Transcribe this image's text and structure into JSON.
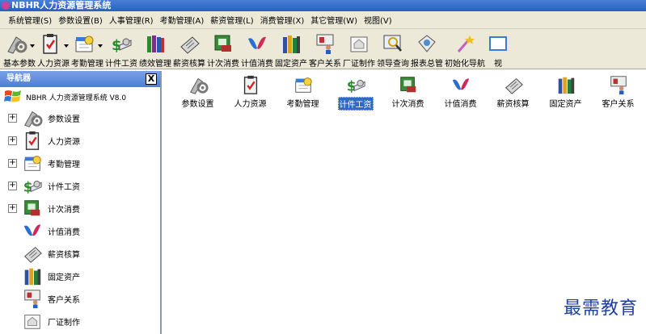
{
  "window": {
    "title": "NBHR人力资源管理系统"
  },
  "menu": [
    "系统管理(S)",
    "参数设置(B)",
    "人事管理(R)",
    "考勤管理(A)",
    "薪资管理(L)",
    "消费管理(X)",
    "其它管理(W)",
    "视图(V)"
  ],
  "toolbar": [
    {
      "label": "基本参数",
      "icon": "params-icon",
      "dropdown": true
    },
    {
      "label": "人力资源",
      "icon": "clipboard-icon",
      "dropdown": true
    },
    {
      "label": "考勤管理",
      "icon": "attendance-icon",
      "dropdown": true
    },
    {
      "label": "计件工资",
      "icon": "piece-wage-icon"
    },
    {
      "label": "绩效管理",
      "icon": "books-icon"
    },
    {
      "label": "薪资核算",
      "icon": "newspaper-icon"
    },
    {
      "label": "计次消费",
      "icon": "count-consume-icon"
    },
    {
      "label": "计值消费",
      "icon": "value-consume-icon"
    },
    {
      "label": "固定资产",
      "icon": "assets-icon"
    },
    {
      "label": "客户关系",
      "icon": "customer-icon"
    },
    {
      "label": "厂证制作",
      "icon": "card-icon"
    },
    {
      "label": "领导查询",
      "icon": "query-icon"
    },
    {
      "label": "报表总管",
      "icon": "report-icon"
    },
    {
      "label": "初始化导航",
      "icon": "wand-icon"
    },
    {
      "label": "视",
      "icon": "view-icon"
    }
  ],
  "navigator": {
    "title": "导航器",
    "close": "X",
    "root": "NBHR 人力资源管理系统 V8.0",
    "items": [
      {
        "label": "参数设置",
        "icon": "params-icon",
        "expandable": true
      },
      {
        "label": "人力资源",
        "icon": "clipboard-icon",
        "expandable": true
      },
      {
        "label": "考勤管理",
        "icon": "attendance-icon",
        "expandable": true
      },
      {
        "label": "计件工资",
        "icon": "piece-wage-icon",
        "expandable": true
      },
      {
        "label": "计次消费",
        "icon": "count-consume-icon",
        "expandable": true
      },
      {
        "label": "计值消费",
        "icon": "value-consume-icon",
        "expandable": false
      },
      {
        "label": "薪资核算",
        "icon": "newspaper-icon",
        "expandable": false
      },
      {
        "label": "固定资产",
        "icon": "assets-icon",
        "expandable": false
      },
      {
        "label": "客户关系",
        "icon": "customer-icon",
        "expandable": false
      },
      {
        "label": "厂证制作",
        "icon": "card-icon",
        "expandable": false
      }
    ]
  },
  "main": {
    "selected_index": 3,
    "items": [
      {
        "label": "参数设置",
        "icon": "params-icon"
      },
      {
        "label": "人力资源",
        "icon": "clipboard-icon"
      },
      {
        "label": "考勤管理",
        "icon": "attendance-icon"
      },
      {
        "label": "计件工资",
        "icon": "piece-wage-icon"
      },
      {
        "label": "计次消费",
        "icon": "count-consume-icon"
      },
      {
        "label": "计值消费",
        "icon": "value-consume-icon"
      },
      {
        "label": "薪资核算",
        "icon": "newspaper-icon"
      },
      {
        "label": "固定资产",
        "icon": "assets-icon"
      },
      {
        "label": "客户关系",
        "icon": "customer-icon"
      }
    ]
  },
  "watermark": "最需教育",
  "colors": {
    "selection": "#316ac5",
    "title_bar": "#2a5fc0",
    "chrome": "#ece9d8",
    "watermark": "#1e3fa0"
  }
}
